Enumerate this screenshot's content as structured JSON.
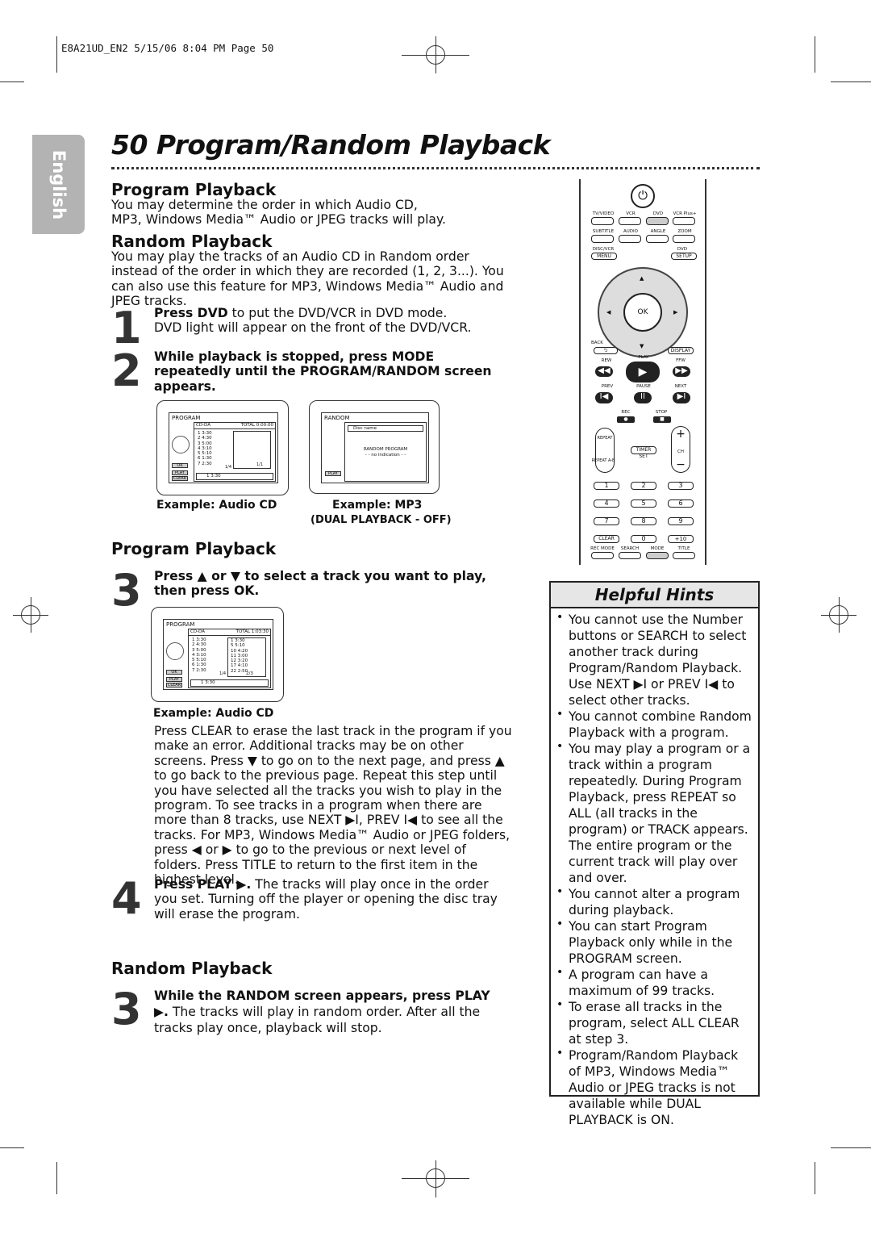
{
  "slug": "E8A21UD_EN2  5/15/06  8:04 PM  Page 50",
  "language_tab": "English",
  "title": "50  Program/Random Playback",
  "intro": {
    "program_heading": "Program Playback",
    "program_text": "You may determine the order in which Audio CD, MP3, Windows Media™ Audio or JPEG tracks will play.",
    "random_heading": "Random Playback",
    "random_text": "You may play the tracks of an Audio CD in Random order instead of the order in which they are recorded (1, 2, 3...). You can also use this feature for MP3, Windows Media™ Audio and JPEG tracks."
  },
  "steps": {
    "s1_num": "1",
    "s1_bold": "Press DVD",
    "s1_text": " to put the DVD/VCR in DVD mode. DVD light will appear on the front of the DVD/VCR.",
    "s2_num": "2",
    "s2_text": "While playback is stopped, press MODE repeatedly until the PROGRAM/RANDOM screen appears.",
    "cap1": "Example: Audio CD",
    "cap2": "Example: MP3",
    "cap2b": "(DUAL PLAYBACK - OFF)",
    "program_heading": "Program Playback",
    "s3_num": "3",
    "s3_text": "Press ▲ or ▼ to select a track you want to play, then press OK.",
    "cap3": "Example: Audio CD",
    "s3_body": "Press CLEAR to erase the last track in the program if you make an error. Additional tracks may be on other screens. Press ▼ to go on to the next page, and press ▲ to go back to the previous page. Repeat this step until you have selected all the tracks you wish to play in the program. To see tracks in a program when there are more than 8 tracks, use NEXT ▶I, PREV I◀ to see all the tracks. For MP3, Windows Media™ Audio or JPEG folders, press ◀ or ▶ to go to the previous or next level of folders. Press TITLE to return to the first item in the highest level.",
    "s4_num": "4",
    "s4_bold": "Press PLAY ▶.",
    "s4_text": " The tracks will play once in the order you set. Turning off the player or opening the disc tray will erase the program.",
    "random_heading": "Random Playback",
    "r3_num": "3",
    "r3_bold": "While the RANDOM screen appears, press PLAY ▶.",
    "r3_text": " The tracks will play in random order. After all the tracks play once, playback will stop."
  },
  "screen_program": {
    "title": "PROGRAM",
    "disc": "CD-DA",
    "total": "TOTAL 0:00:00",
    "tracks": [
      "1  3:30",
      "2  4:30",
      "3  5:00",
      "4  3:10",
      "5  5:10",
      "6  1:30",
      "7  2:30"
    ],
    "page": "1/4",
    "page2": "1/1",
    "selected": "1  3:30",
    "ok": "OK",
    "play": "PLAY",
    "clear": "CLEAR"
  },
  "screen_random": {
    "title": "RANDOM",
    "disc": "Disc name",
    "line1": "RANDOM  PROGRAM",
    "line2": "- -  no  indication  - -",
    "play": "PLAY"
  },
  "screen_program2": {
    "title": "PROGRAM",
    "disc": "CD-DA",
    "total": "TOTAL 1:03:30",
    "tracks": [
      "1  3:30",
      "2  4:30",
      "3  5:00",
      "4  3:10",
      "5  5:10",
      "6  1:30",
      "7  2:30"
    ],
    "program": [
      "1    3:30",
      "5    5:10",
      "10  4:20",
      "11  3:00",
      "12  3:20",
      "17  4:10",
      "22  2:50"
    ],
    "page": "1/4",
    "page2": "2/3",
    "selected": "1  3:30",
    "ok": "OK",
    "play": "PLAY",
    "clear": "CLEAR"
  },
  "remote": {
    "row1": [
      "TV/VIDEO",
      "VCR",
      "DVD",
      "VCR Plus+"
    ],
    "row2": [
      "SUBTITLE",
      "AUDIO",
      "ANGLE",
      "ZOOM"
    ],
    "disc_vcr": "DISC/VCR",
    "menu": "MENU",
    "dvd": "DVD",
    "setup": "SETUP",
    "ok": "OK",
    "back": "BACK",
    "display": "DISPLAY",
    "play": "PLAY",
    "rew": "REW",
    "ffw": "FFW",
    "prev": "PREV",
    "pause": "PAUSE",
    "next": "NEXT",
    "rec": "REC",
    "stop": "STOP",
    "repeat": "REPEAT",
    "repeat_ab": "REPEAT A-B",
    "timer_set": "TIMER SET",
    "ch": "CH",
    "digits": [
      "1",
      "2",
      "3",
      "4",
      "5",
      "6",
      "7",
      "8",
      "9"
    ],
    "clear": "CLEAR",
    "zero": "0",
    "plus10": "+10",
    "bottom": [
      "REC MODE",
      "SEARCH",
      "MODE",
      "TITLE"
    ],
    "highlight": "#cccccc"
  },
  "hints": {
    "title": "Helpful Hints",
    "items": [
      "You cannot use the Number buttons or SEARCH to select another track during Program/Random Playback. Use NEXT ▶I or PREV I◀ to select other tracks.",
      "You cannot combine Random Playback with a program.",
      "You may play a program or a track within a program repeatedly. During Program Playback, press REPEAT so ALL (all tracks in the program) or TRACK appears. The entire program or the current track will play over and over.",
      "You cannot alter a program during playback.",
      "You can start Program Playback only while in the PROGRAM screen.",
      "A program can have a maximum of 99 tracks.",
      "To erase all tracks in the program, select ALL CLEAR at step 3.",
      "Program/Random Playback of MP3, Windows Media™ Audio or JPEG tracks is not available while DUAL PLAYBACK is ON."
    ]
  }
}
